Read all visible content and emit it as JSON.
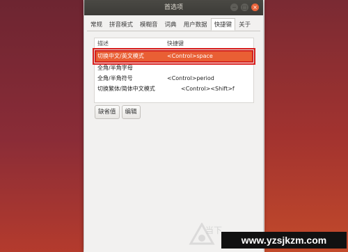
{
  "window": {
    "title": "首选项",
    "controls": [
      "−",
      "□",
      "×"
    ]
  },
  "tabs": [
    {
      "label": "常规",
      "active": false
    },
    {
      "label": "拼音模式",
      "active": false
    },
    {
      "label": "模糊音",
      "active": false
    },
    {
      "label": "词典",
      "active": false
    },
    {
      "label": "用户数据",
      "active": false
    },
    {
      "label": "快捷键",
      "active": true
    },
    {
      "label": "关于",
      "active": false
    }
  ],
  "shortcuts": {
    "columns": [
      "描述",
      "快捷键"
    ],
    "rows": [
      {
        "desc": "切换中文/英文模式",
        "key": "<Control>space",
        "selected": true
      },
      {
        "desc": "全角/半角字母",
        "key": "",
        "selected": false
      },
      {
        "desc": "全角/半角符号",
        "key": "<Control>period",
        "selected": false
      },
      {
        "desc": "切换繁体/简体中文模式",
        "key": "<Control><Shift>f",
        "selected": false
      }
    ]
  },
  "buttons": {
    "default": "缺省值",
    "edit": "编辑"
  },
  "watermark": {
    "faint_text": "当下",
    "site": "www.yzsjkzm.com"
  },
  "colors": {
    "accent": "#e95f34",
    "highlight_box": "#d81d1d",
    "titlebar": "#3c3b37"
  }
}
